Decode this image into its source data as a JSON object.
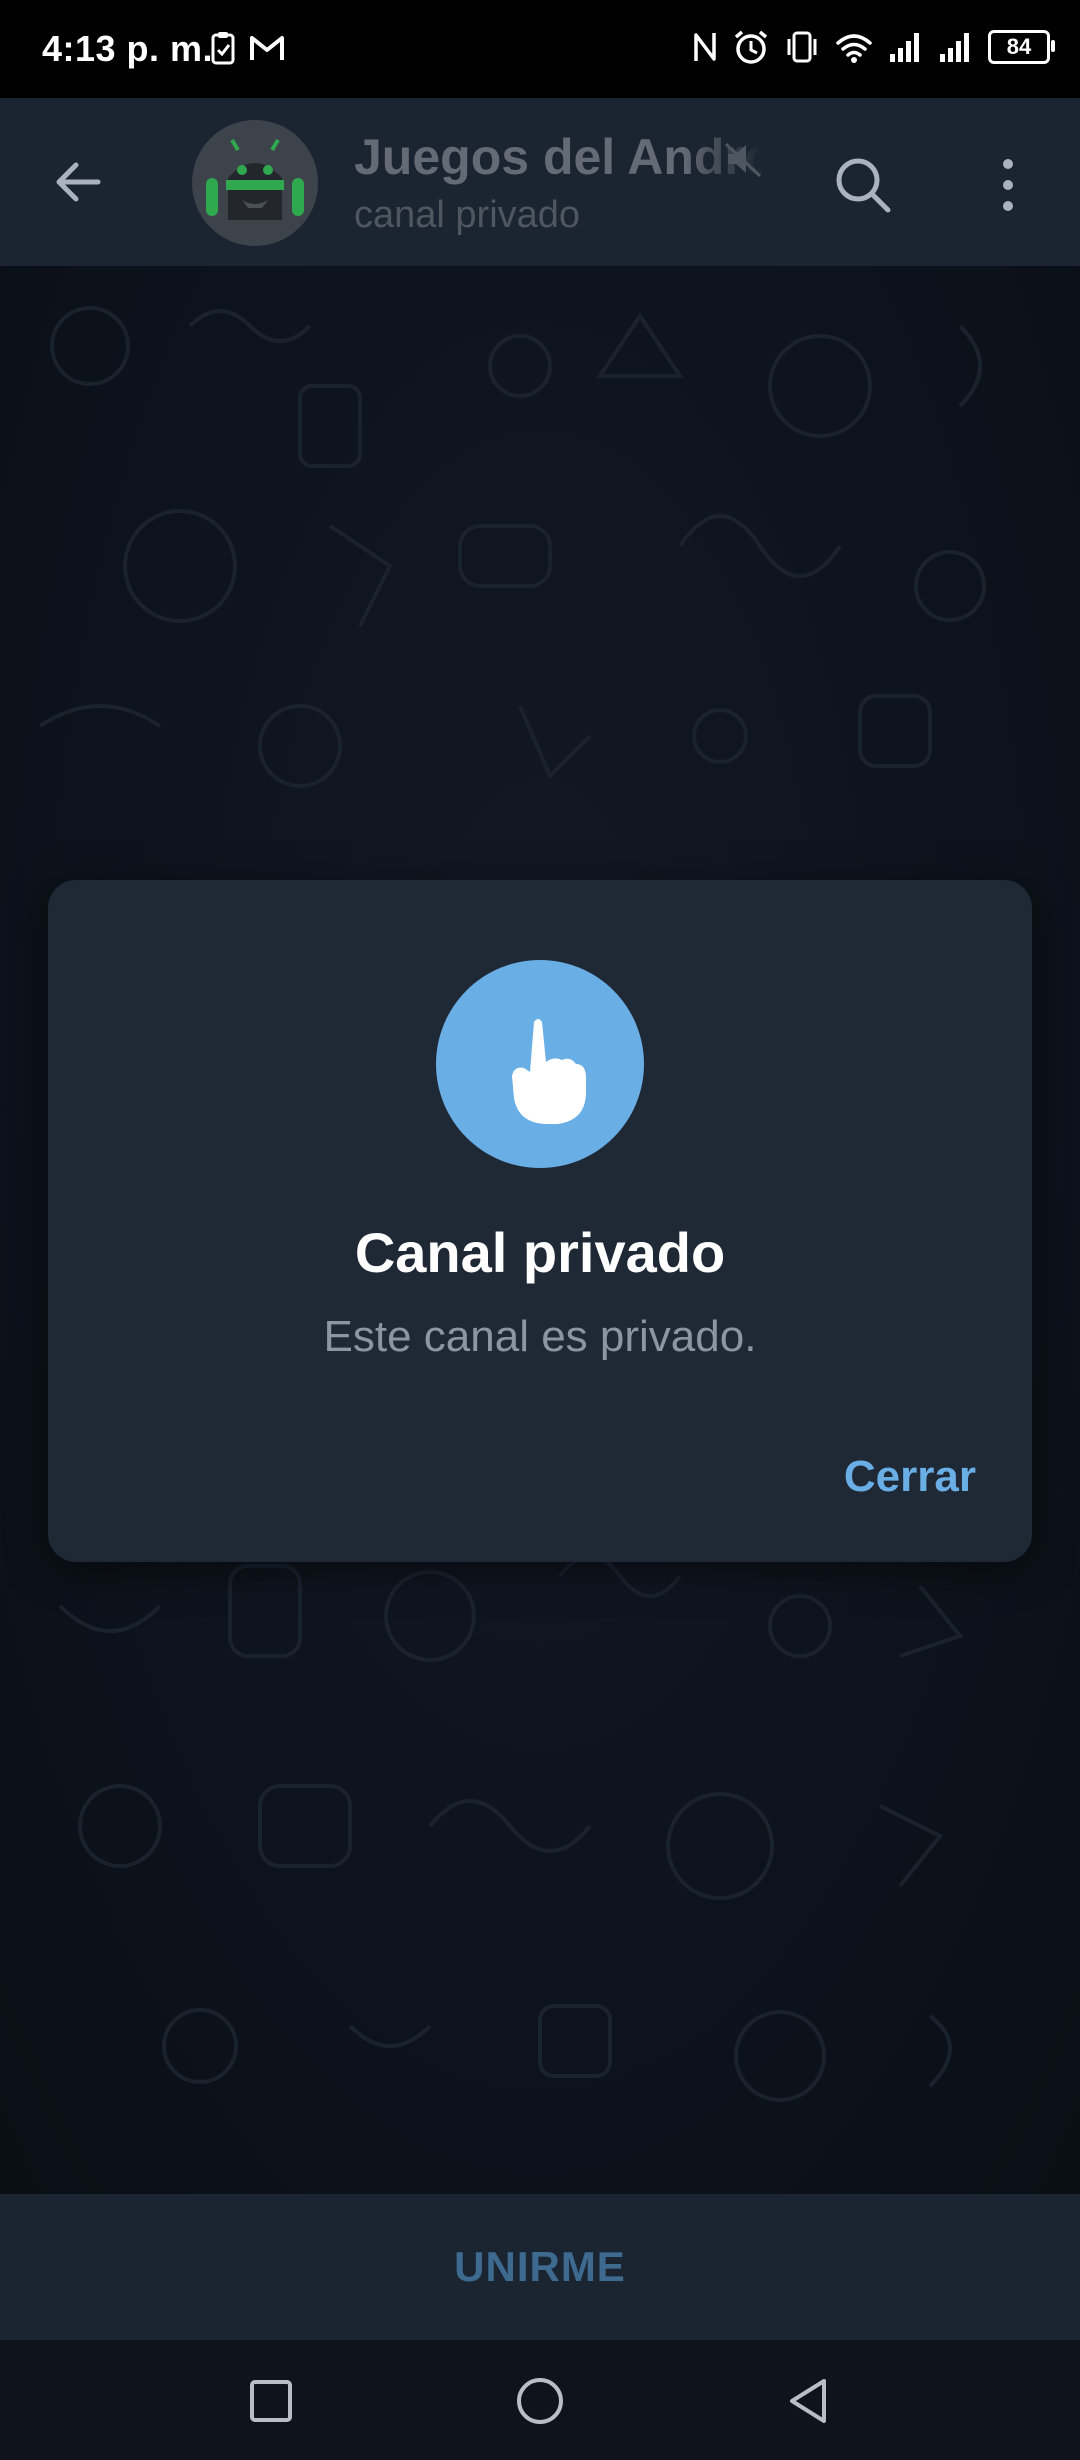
{
  "status_bar": {
    "time": "4:13 p. m.",
    "battery": "84"
  },
  "header": {
    "title": "Juegos del Android",
    "subtitle": "canal privado"
  },
  "dialog": {
    "title": "Canal privado",
    "message": "Este canal es privado.",
    "close_label": "Cerrar"
  },
  "footer": {
    "join_label": "UNIRME"
  },
  "icons": {
    "back": "arrow-left-icon",
    "mute": "muted-speaker-icon",
    "search": "search-icon",
    "menu": "more-vertical-icon",
    "dialog": "pointing-hand-icon",
    "nav_recents": "square-icon",
    "nav_home": "circle-icon",
    "nav_back": "triangle-back-icon"
  },
  "colors": {
    "accent": "#6aaee6",
    "header_bg": "#1b2431",
    "dialog_bg": "#1f2835",
    "join_text": "#3e6a8f"
  }
}
